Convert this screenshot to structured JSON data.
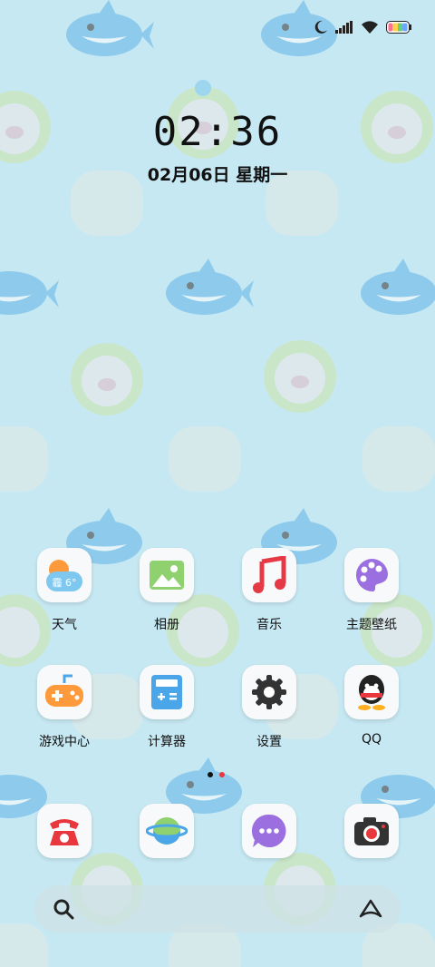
{
  "status_bar": {
    "icons": [
      "moon-icon",
      "signal-icon",
      "wifi-icon",
      "battery-icon"
    ]
  },
  "lockscreen": {
    "time": "02:36",
    "date": "02月06日  星期一"
  },
  "apps_row1": [
    {
      "label": "天气",
      "icon": "weather-icon",
      "weather_text": "霾 6°"
    },
    {
      "label": "相册",
      "icon": "gallery-icon"
    },
    {
      "label": "音乐",
      "icon": "music-icon"
    },
    {
      "label": "主题壁纸",
      "icon": "themes-icon"
    }
  ],
  "apps_row2": [
    {
      "label": "游戏中心",
      "icon": "gamepad-icon"
    },
    {
      "label": "计算器",
      "icon": "calculator-icon"
    },
    {
      "label": "设置",
      "icon": "settings-gear-icon"
    },
    {
      "label": "QQ",
      "icon": "qq-penguin-icon"
    }
  ],
  "dock": [
    {
      "icon": "phone-icon"
    },
    {
      "icon": "browser-planet-icon"
    },
    {
      "icon": "messages-icon"
    },
    {
      "icon": "camera-icon"
    }
  ],
  "page_indicator": {
    "count": 2,
    "active": 0
  },
  "search_bar": {
    "icons": [
      "search-icon",
      "assistant-icon"
    ]
  },
  "colors": {
    "background": "#c6e8f2",
    "accent_red": "#e8383d",
    "weather_orange": "#ff9a3c",
    "music_red": "#e53a46",
    "theme_purple": "#9b6fe0",
    "gallery_green": "#8fd16f"
  }
}
